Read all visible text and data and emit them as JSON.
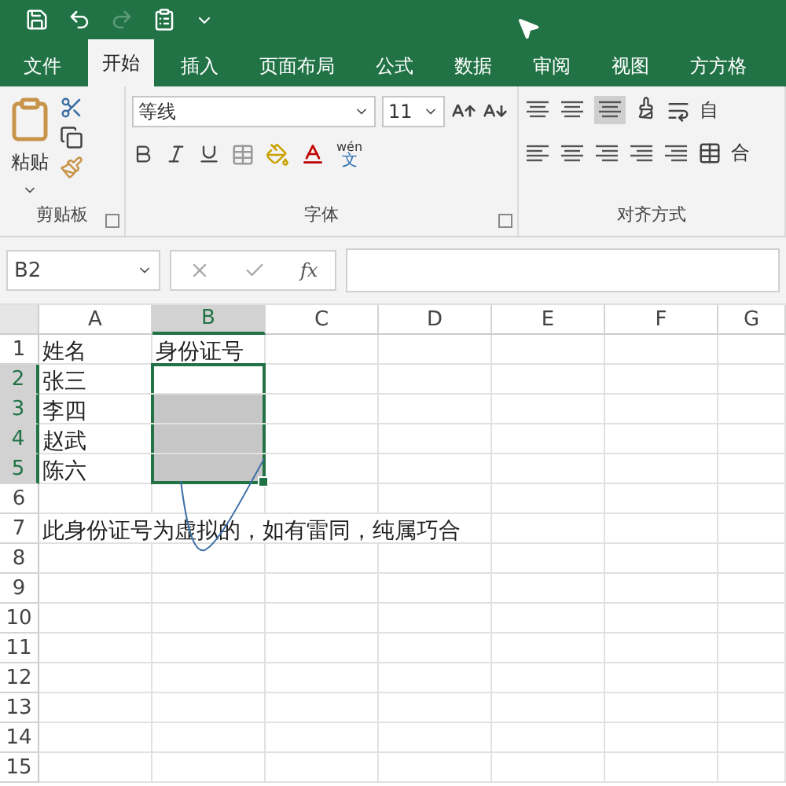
{
  "quick_access": [
    {
      "kind": "save",
      "disabled": false
    },
    {
      "kind": "undo",
      "disabled": false
    },
    {
      "kind": "redo",
      "disabled": true
    },
    {
      "kind": "form",
      "disabled": false
    },
    {
      "kind": "customize",
      "disabled": false
    }
  ],
  "tabs": [
    {
      "label": "文件",
      "selected": false
    },
    {
      "label": "开始",
      "selected": true
    },
    {
      "label": "插入",
      "selected": false
    },
    {
      "label": "页面布局",
      "selected": false
    },
    {
      "label": "公式",
      "selected": false
    },
    {
      "label": "数据",
      "selected": false
    },
    {
      "label": "审阅",
      "selected": false
    },
    {
      "label": "视图",
      "selected": false
    },
    {
      "label": "方方格",
      "selected": false
    }
  ],
  "ribbon": {
    "clipboard": {
      "paste_label": "粘贴",
      "group_label": "剪贴板"
    },
    "font": {
      "font_name": "等线",
      "font_size": "11",
      "phonetic_top": "wén",
      "phonetic_bottom": "文",
      "group_label": "字体"
    },
    "alignment": {
      "wrap_label": "自",
      "merge_label": "合",
      "group_label": "对齐方式"
    }
  },
  "formula_bar": {
    "name_box": "B2",
    "fx": "fx"
  },
  "columns": [
    {
      "label": "A",
      "selected": false
    },
    {
      "label": "B",
      "selected": true
    },
    {
      "label": "C",
      "selected": false
    },
    {
      "label": "D",
      "selected": false
    },
    {
      "label": "E",
      "selected": false
    },
    {
      "label": "F",
      "selected": false
    },
    {
      "label": "G",
      "selected": false
    }
  ],
  "rows": [
    {
      "label": "1",
      "selected": false,
      "cells": [
        {
          "text": "姓名"
        },
        {
          "text": "身份证号"
        }
      ]
    },
    {
      "label": "2",
      "selected": true,
      "cells": [
        {
          "text": "张三"
        },
        {
          "selected": true,
          "active": true
        }
      ]
    },
    {
      "label": "3",
      "selected": true,
      "cells": [
        {
          "text": "李四"
        },
        {
          "selected": true,
          "active": false
        }
      ]
    },
    {
      "label": "4",
      "selected": true,
      "cells": [
        {
          "text": "赵武"
        },
        {
          "selected": true,
          "active": false
        }
      ]
    },
    {
      "label": "5",
      "selected": true,
      "cells": [
        {
          "text": "陈六"
        },
        {
          "selected": true,
          "active": false
        }
      ]
    },
    {
      "label": "6",
      "selected": false,
      "cells": []
    },
    {
      "label": "7",
      "selected": false,
      "cells": [
        {
          "text": "此身份证号为虚拟的，如有雷同，纯属巧合"
        }
      ]
    },
    {
      "label": "8",
      "selected": false,
      "cells": []
    },
    {
      "label": "9",
      "selected": false,
      "cells": []
    },
    {
      "label": "10",
      "selected": false,
      "cells": []
    },
    {
      "label": "11",
      "selected": false,
      "cells": []
    },
    {
      "label": "12",
      "selected": false,
      "cells": []
    },
    {
      "label": "13",
      "selected": false,
      "cells": []
    },
    {
      "label": "14",
      "selected": false,
      "cells": []
    },
    {
      "label": "15",
      "selected": false,
      "cells": []
    }
  ]
}
